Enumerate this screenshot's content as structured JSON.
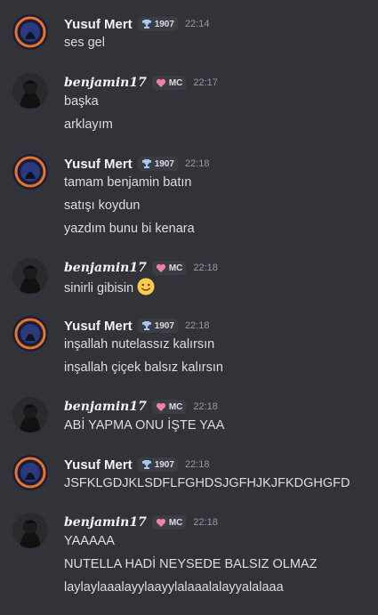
{
  "users": {
    "yusuf": {
      "name": "Yusuf Mert",
      "badge_icon": "trophy-icon",
      "badge_text": "1907"
    },
    "benjamin": {
      "name": "benjamin17",
      "badge_icon": "heart-icon",
      "badge_text": "MC"
    }
  },
  "messages": [
    {
      "author": "Yusuf Mert",
      "badge": "1907",
      "time": "22:14",
      "lines": [
        "ses gel"
      ]
    },
    {
      "author": "benjamin17",
      "badge": "MC",
      "time": "22:17",
      "lines": [
        "başka",
        "arklayım"
      ]
    },
    {
      "author": "Yusuf Mert",
      "badge": "1907",
      "time": "22:18",
      "lines": [
        "tamam benjamin batın",
        "satışı koydun",
        "yazdım bunu bi kenara"
      ]
    },
    {
      "author": "benjamin17",
      "badge": "MC",
      "time": "22:18",
      "lines": [
        "sinirli gibisin"
      ],
      "emoji": "slightly-smiling-face-emoji"
    },
    {
      "author": "Yusuf Mert",
      "badge": "1907",
      "time": "22:18",
      "lines": [
        "inşallah nutelassız kalırsın",
        "inşallah çiçek balsız kalırsın"
      ]
    },
    {
      "author": "benjamin17",
      "badge": "MC",
      "time": "22:18",
      "lines": [
        "ABİ YAPMA ONU İŞTE YAA"
      ]
    },
    {
      "author": "Yusuf Mert",
      "badge": "1907",
      "time": "22:18",
      "lines": [
        "JSFKLGDJKLSDFLFGHDSJGFHJKJFKDGHGFD"
      ]
    },
    {
      "author": "benjamin17",
      "badge": "MC",
      "time": "22:18",
      "lines": [
        "YAAAAA",
        "NUTELLA HADİ NEYSEDE BALSIZ OLMAZ",
        "laylaylaaalayylaayylalaaalalayyalalaaa"
      ]
    }
  ],
  "colors": {
    "background": "#313338",
    "username": "#f2f3f5",
    "text": "#dbdee1",
    "timestamp": "#949ba4",
    "badge_bg": "#3b3d44",
    "heart": "#f47fa8",
    "trophy": "#a7c8f0"
  }
}
